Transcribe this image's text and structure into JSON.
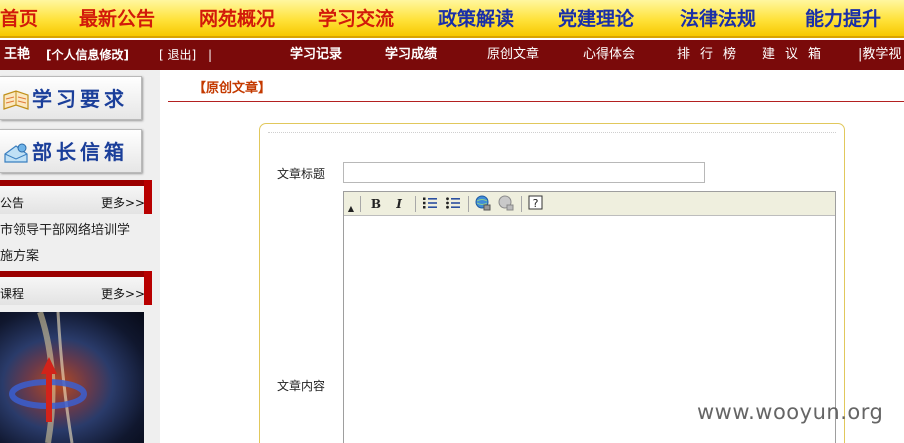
{
  "top_nav": {
    "items": [
      "首页",
      "最新公告",
      "网苑概况",
      "学习交流",
      "政策解读",
      "党建理论",
      "法律法规",
      "能力提升"
    ]
  },
  "user_bar": {
    "user_name": "王艳",
    "profile_link": "[个人信息修改]",
    "logout": "[ 退出]",
    "sep": "|",
    "tabs": [
      "学习记录",
      "学习成绩",
      "原创文章",
      "心得体会",
      "排行榜",
      "建议箱",
      "|教学视"
    ]
  },
  "sidebar": {
    "buttons": [
      "学习要求",
      "部长信箱"
    ],
    "notice_title": "公告",
    "notice_more": "更多>>",
    "notice_line1": "市领导干部网络培训学",
    "notice_line2": "施方案",
    "course_title": "课程",
    "course_more": "更多>>"
  },
  "main": {
    "breadcrumb": "【原创文章】",
    "title_label": "文章标题",
    "title_value": "",
    "content_label": "文章内容",
    "toolbar": {
      "bold": "B",
      "italic": "I",
      "buttons": [
        "bold",
        "italic",
        "ordered-list",
        "unordered-list",
        "insert-link",
        "unlink",
        "help"
      ]
    }
  },
  "watermark": "www.wooyun.org",
  "colors": {
    "nav_bg": "#ffe23a",
    "nav_red": "#d21a0a",
    "nav_blue": "#1a2fa8",
    "user_bar_bg": "#7a0a0a",
    "accent_red": "#b32020",
    "form_border": "#e1c85c"
  }
}
